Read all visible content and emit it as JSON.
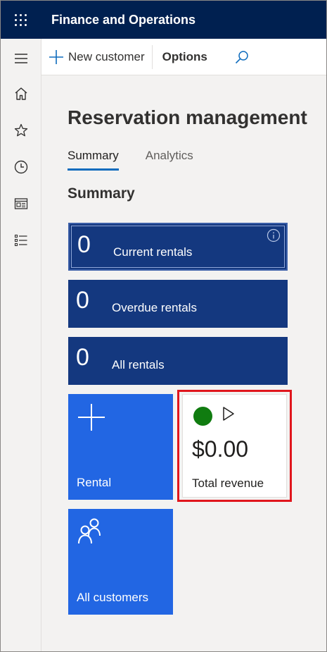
{
  "appbar": {
    "title": "Finance and Operations"
  },
  "nav": {
    "items": [
      {
        "icon": "menu-icon"
      },
      {
        "icon": "home-icon"
      },
      {
        "icon": "star-icon"
      },
      {
        "icon": "clock-icon"
      },
      {
        "icon": "workspace-icon"
      },
      {
        "icon": "modules-icon"
      }
    ]
  },
  "actionpane": {
    "new_customer": "New customer",
    "options": "Options"
  },
  "page": {
    "title": "Reservation management",
    "tabs": [
      {
        "label": "Summary",
        "active": true
      },
      {
        "label": "Analytics",
        "active": false
      }
    ],
    "section_title": "Summary"
  },
  "tiles": {
    "current_rentals": {
      "count": "0",
      "label": "Current rentals"
    },
    "overdue_rentals": {
      "count": "0",
      "label": "Overdue rentals"
    },
    "all_rentals": {
      "count": "0",
      "label": "All rentals"
    },
    "rental": {
      "label": "Rental"
    },
    "total_revenue": {
      "value": "$0.00",
      "label": "Total revenue",
      "status_color": "#107c10"
    },
    "all_customers": {
      "label": "All customers"
    }
  },
  "colors": {
    "appbar": "#002050",
    "count_tile": "#14387f",
    "action_tile": "#2266e3",
    "highlight": "#e0161d"
  }
}
